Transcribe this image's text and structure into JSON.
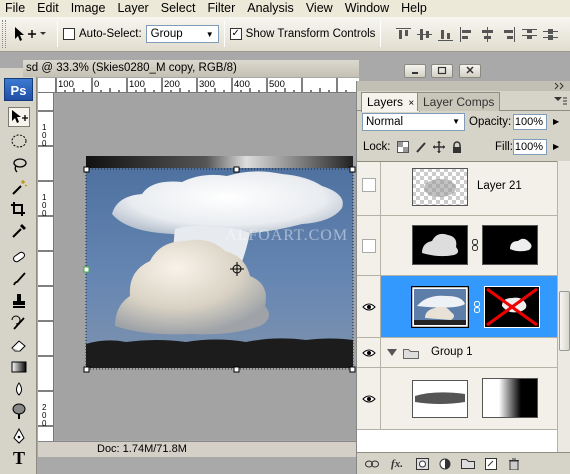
{
  "menu": [
    "File",
    "Edit",
    "Image",
    "Layer",
    "Select",
    "Filter",
    "Analysis",
    "View",
    "Window",
    "Help"
  ],
  "options": {
    "auto_select_label": "Auto-Select:",
    "auto_select_checked": false,
    "auto_select_value": "Group",
    "show_transform_label": "Show Transform Controls",
    "show_transform_checked": true
  },
  "document": {
    "title_fragment": "sd @ 33.3% (Skies0280_M copy, RGB/8)",
    "ruler_top_labels": [
      "100",
      "0",
      "100",
      "200",
      "300",
      "400",
      "500"
    ],
    "ruler_left_labels": [
      "1",
      "0",
      "0",
      "1",
      "0",
      "0",
      "2",
      "0",
      "0"
    ],
    "watermark": "ALFOART.COM",
    "status_doc": "Doc: 1.74M/71.8M"
  },
  "tools": {
    "logo": "Ps",
    "type_tool_glyph": "T"
  },
  "layers_panel": {
    "tabs": [
      "Layers",
      "Layer Comps"
    ],
    "blend_mode": "Normal",
    "opacity_label": "Opacity:",
    "opacity_value": "100%",
    "lock_label": "Lock:",
    "fill_label": "Fill:",
    "fill_value": "100%",
    "layers": [
      {
        "name": "Layer 21",
        "visible": false
      },
      {
        "name": "",
        "visible": false
      },
      {
        "name": "",
        "visible": true,
        "selected": true
      },
      {
        "name": "Group 1",
        "visible": true,
        "group": true
      },
      {
        "name": "",
        "visible": true
      }
    ],
    "footer_fx": "fx."
  },
  "colors": {
    "selection": "#3399ff",
    "ps_logo": "#2b62c0",
    "sky": "#5175a6"
  }
}
